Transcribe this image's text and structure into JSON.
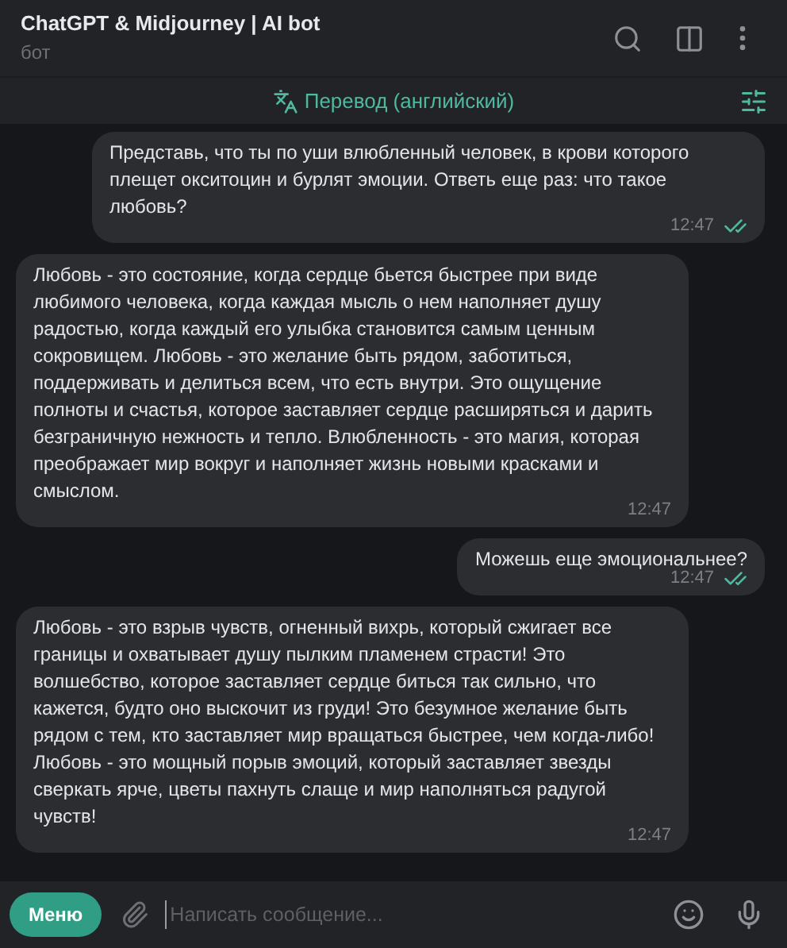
{
  "header": {
    "title": "ChatGPT & Midjourney | AI bot",
    "subtitle": "бот"
  },
  "translate_bar": {
    "label": "Перевод (английский)"
  },
  "messages": [
    {
      "kind": "outgoing",
      "text": "Представь, что ты по уши влюбленный человек, в крови которого плещет окситоцин и бурлят эмоции. Ответь еще раз: что такое любовь?",
      "time": "12:47",
      "read": true
    },
    {
      "kind": "incoming",
      "text": "Любовь - это состояние, когда сердце бьется быстрее при виде любимого человека, когда каждая мысль о нем наполняет душу радостью, когда каждый его улыбка становится самым ценным сокровищем. Любовь - это желание быть рядом, заботиться, поддерживать и делиться всем, что есть внутри. Это ощущение полноты и счастья, которое заставляет сердце расширяться и дарить безграничную нежность и тепло. Влюбленность - это магия, которая преображает мир вокруг и наполняет жизнь новыми красками и смыслом.",
      "time": "12:47"
    },
    {
      "kind": "outgoing",
      "text": "Можешь еще эмоциональнее?",
      "time": "12:47",
      "read": true
    },
    {
      "kind": "incoming",
      "text": "Любовь - это взрыв чувств, огненный вихрь, который сжигает все границы и охватывает душу пылким пламенем страсти! Это волшебство, которое заставляет сердце биться так сильно, что кажется, будто оно выскочит из груди! Это безумное желание быть рядом с тем, кто заставляет мир вращаться быстрее, чем когда-либо! Любовь - это мощный порыв эмоций, который заставляет звезды сверкать ярче, цветы пахнуть слаще и мир наполняться радугой чувств!",
      "time": "12:47"
    }
  ],
  "composer": {
    "menu_button": "Меню",
    "placeholder": "Написать сообщение..."
  }
}
